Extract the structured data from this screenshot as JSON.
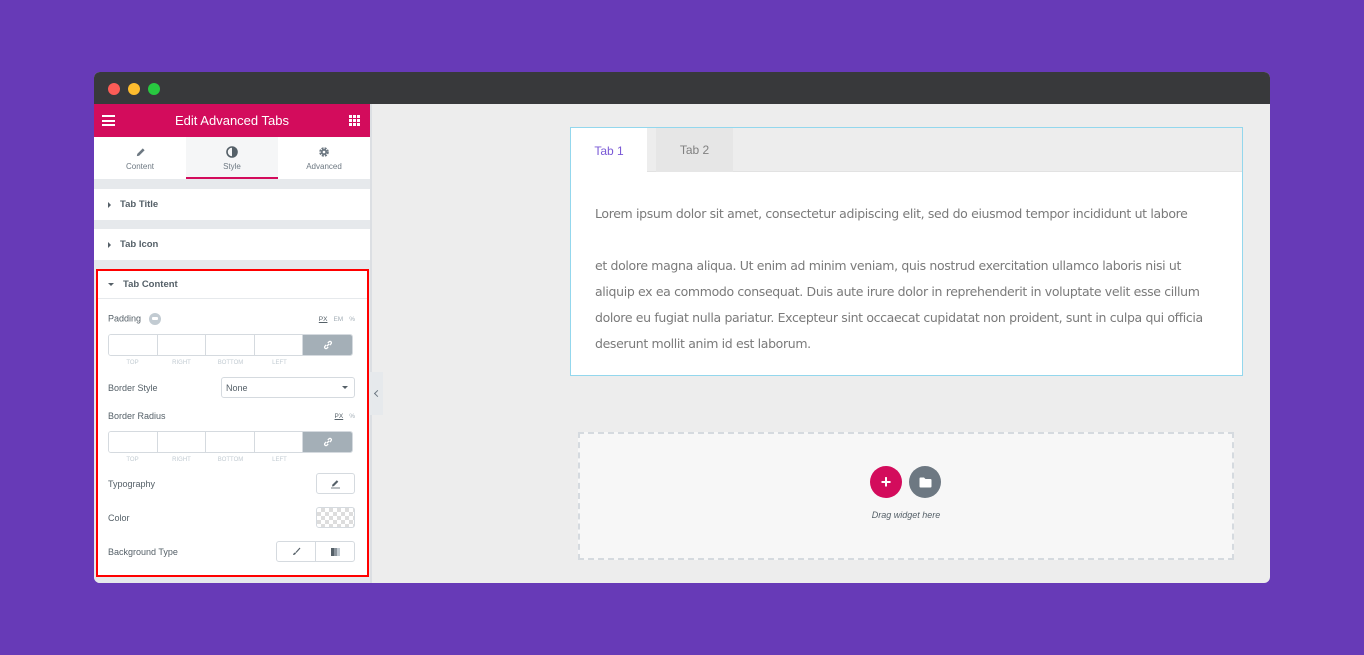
{
  "window": {
    "controls": [
      "close",
      "minimize",
      "maximize"
    ]
  },
  "panel": {
    "title": "Edit Advanced Tabs",
    "menu_icon": "hamburger-icon",
    "widgets_icon": "grid-icon",
    "tabs": [
      {
        "label": "Content",
        "icon": "pencil-icon",
        "active": false
      },
      {
        "label": "Style",
        "icon": "contrast-icon",
        "active": true
      },
      {
        "label": "Advanced",
        "icon": "gear-icon",
        "active": false
      }
    ],
    "sections": [
      {
        "label": "Tab Title",
        "expanded": false
      },
      {
        "label": "Tab Icon",
        "expanded": false
      },
      {
        "label": "Tab Content",
        "expanded": true
      }
    ],
    "tab_content": {
      "padding": {
        "label": "Padding",
        "units": [
          "PX",
          "EM",
          "%"
        ],
        "selected_unit": "PX",
        "fields": {
          "top": "",
          "right": "",
          "bottom": "",
          "left": ""
        },
        "field_labels": [
          "TOP",
          "RIGHT",
          "BOTTOM",
          "LEFT"
        ]
      },
      "border_style": {
        "label": "Border Style",
        "value": "None"
      },
      "border_radius": {
        "label": "Border Radius",
        "units": [
          "PX",
          "%"
        ],
        "selected_unit": "PX",
        "fields": {
          "top": "",
          "right": "",
          "bottom": "",
          "left": ""
        },
        "field_labels": [
          "TOP",
          "RIGHT",
          "BOTTOM",
          "LEFT"
        ]
      },
      "typography": {
        "label": "Typography"
      },
      "color": {
        "label": "Color"
      },
      "background_type": {
        "label": "Background Type",
        "options": [
          "classic",
          "gradient"
        ]
      }
    }
  },
  "canvas": {
    "tabs": [
      {
        "label": "Tab 1",
        "active": true
      },
      {
        "label": "Tab 2",
        "active": false
      }
    ],
    "content": [
      "Lorem ipsum dolor sit amet, consectetur adipiscing elit, sed do eiusmod tempor incididunt ut labore",
      "et dolore magna aliqua. Ut enim ad minim veniam, quis nostrud exercitation ullamco laboris nisi ut aliquip ex ea commodo consequat. Duis aute irure dolor in reprehenderit in voluptate velit esse cillum dolore eu fugiat nulla pariatur. Excepteur sint occaecat cupidatat non proident, sunt in culpa qui officia deserunt mollit anim id est laborum."
    ],
    "dropzone": {
      "label": "Drag widget here",
      "add_label": "+"
    }
  },
  "colors": {
    "background": "#673ab7",
    "brand": "#d30c5c",
    "active_tab": "#7a59d6",
    "highlight_border": "#ff0000",
    "widget_border": "#93d7ed"
  }
}
